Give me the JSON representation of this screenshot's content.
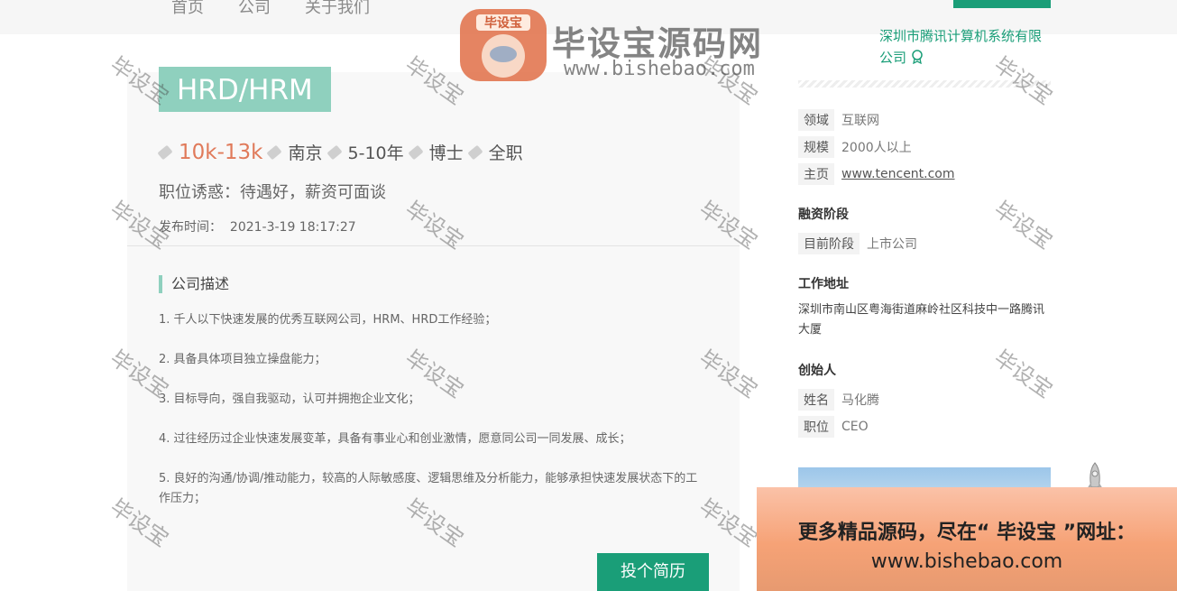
{
  "nav": {
    "items": [
      "首页",
      "公司",
      "关于我们"
    ]
  },
  "job": {
    "title": "HRD/HRM",
    "salary": "10k-13k",
    "city": "南京",
    "experience": "5-10年",
    "education": "博士",
    "job_type": "全职",
    "lure": "职位诱惑：待遇好，薪资可面谈",
    "publish_label": "发布时间：",
    "publish_time": "2021-3-19 18:17:27",
    "section_title": "公司描述",
    "description": [
      "1. 千人以下快速发展的优秀互联网公司，HRM、HRD工作经验；",
      "2. 具备具体项目独立操盘能力；",
      "3. 目标导向，强自我驱动，认可并拥抱企业文化；",
      "4. 过往经历过企业快速发展变革，具备有事业心和创业激情，愿意同公司一同发展、成长；",
      "5. 良好的沟通/协调/推动能力，较高的人际敏感度、逻辑思维及分析能力，能够承担快速发展状态下的工作压力；"
    ],
    "apply_label": "投个简历"
  },
  "company": {
    "name": "深圳市腾讯计算机系统有限公司",
    "field_label": "领域",
    "field": "互联网",
    "scale_label": "规模",
    "scale": "2000人以上",
    "homepage_label": "主页",
    "homepage": "www.tencent.com",
    "funding_title": "融资阶段",
    "stage_label": "目前阶段",
    "stage": "上市公司",
    "address_title": "工作地址",
    "address": "深圳市南山区粤海街道麻岭社区科技中一路腾讯大厦",
    "founder_title": "创始人",
    "founder_name_label": "姓名",
    "founder_name": "马化腾",
    "founder_pos_label": "职位",
    "founder_pos": "CEO"
  },
  "watermark": {
    "text": "毕设宝",
    "logo_badge": "毕设宝",
    "logo_text": "毕设宝源码网",
    "logo_url": "www.bishebao.com"
  },
  "banner": {
    "line1": "更多精品源码，尽在“ 毕设宝 ”网址：",
    "line2": "www.bishebao.com"
  },
  "colors": {
    "accent": "#1a9e78",
    "title_bg": "#8fd0be",
    "salary": "#e07a5a"
  }
}
